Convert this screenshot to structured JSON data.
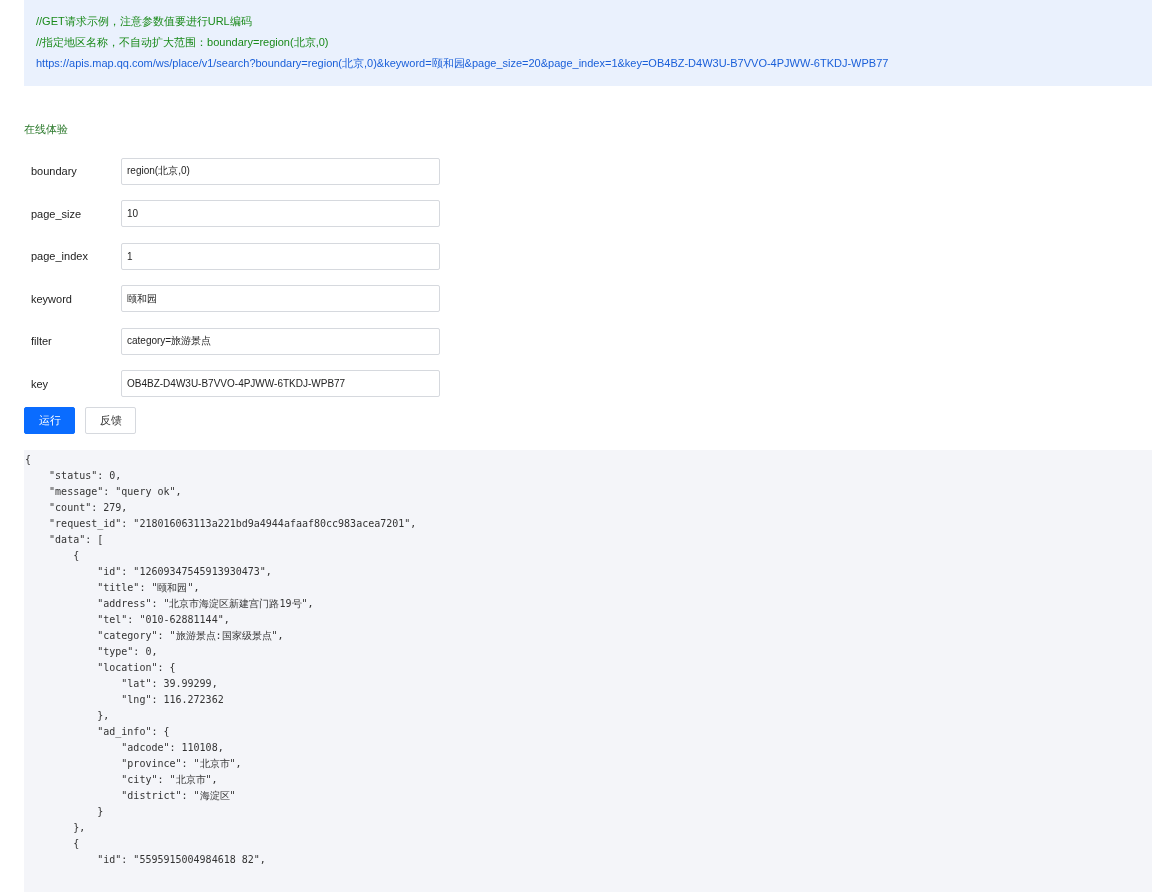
{
  "example": {
    "comments": [
      "//GET请求示例，注意参数值要进行URL编码",
      "//指定地区名称，不自动扩大范围：boundary=region(北京,0)"
    ],
    "url": "https://apis.map.qq.com/ws/place/v1/search?boundary=region(北京,0)&keyword=颐和园&page_size=20&page_index=1&key=OB4BZ-D4W3U-B7VVO-4PJWW-6TKDJ-WPB77"
  },
  "section_title": "在线体验",
  "fields": [
    {
      "label": "boundary",
      "value": "region(北京,0)"
    },
    {
      "label": "page_size",
      "value": "10"
    },
    {
      "label": "page_index",
      "value": "1"
    },
    {
      "label": "keyword",
      "value": "颐和园"
    },
    {
      "label": "filter",
      "value": "category=旅游景点"
    },
    {
      "label": "key",
      "value": "OB4BZ-D4W3U-B7VVO-4PJWW-6TKDJ-WPB77"
    }
  ],
  "buttons": [
    {
      "label": "运行",
      "kind": "primary"
    },
    {
      "label": "反馈",
      "kind": "default"
    }
  ],
  "response_lines": [
    "{",
    "    \"status\": 0,",
    "    \"message\": \"query ok\",",
    "    \"count\": 279,",
    "    \"request_id\": \"218016063113a221bd9a4944afaaf80cc983acea7201\",",
    "    \"data\": [",
    "        {",
    "            \"id\": \"12609347545913930473\",",
    "            \"title\": \"颐和园\",",
    "            \"address\": \"北京市海淀区新建宫门路19号\",",
    "            \"tel\": \"010-62881144\",",
    "            \"category\": \"旅游景点:国家级景点\",",
    "            \"type\": 0,",
    "            \"location\": {",
    "                \"lat\": 39.99299,",
    "                \"lng\": 116.272362",
    "            },",
    "            \"ad_info\": {",
    "                \"adcode\": 110108,",
    "                \"province\": \"北京市\",",
    "                \"city\": \"北京市\",",
    "                \"district\": \"海淀区\"",
    "            }",
    "        },",
    "        {",
    "            \"id\": \"5595915004984618 82\","
  ]
}
